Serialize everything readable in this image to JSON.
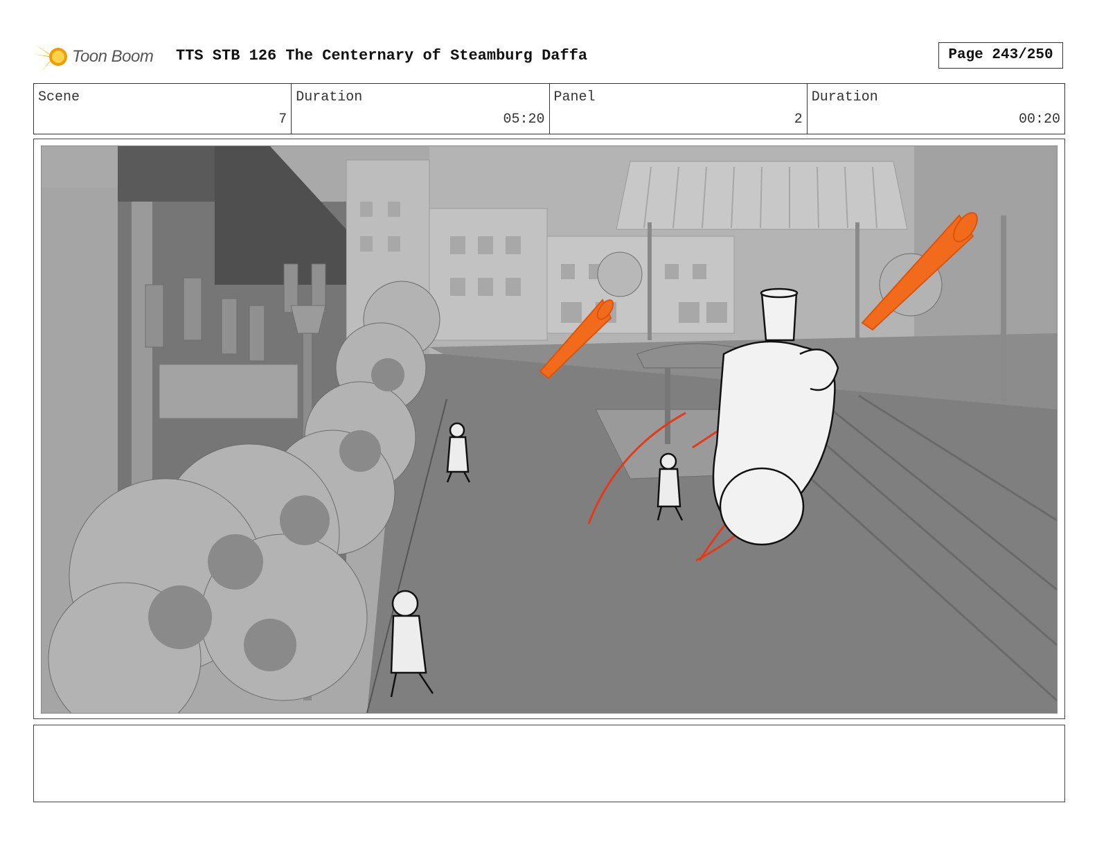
{
  "header": {
    "logo_text": "Toon Boom",
    "title": "TTS STB 126 The Centernary of Steamburg Daffa",
    "page": "Page 243/250"
  },
  "info": {
    "scene_label": "Scene",
    "scene_value": "7",
    "scene_duration_label": "Duration",
    "scene_duration_value": "05:20",
    "panel_label": "Panel",
    "panel_value": "2",
    "panel_duration_label": "Duration",
    "panel_duration_value": "00:20"
  },
  "colors": {
    "accent_orange": "#f26a1b",
    "logo_yellow": "#f7b500",
    "scene_gray": "#8a8a8a"
  },
  "notes": ""
}
